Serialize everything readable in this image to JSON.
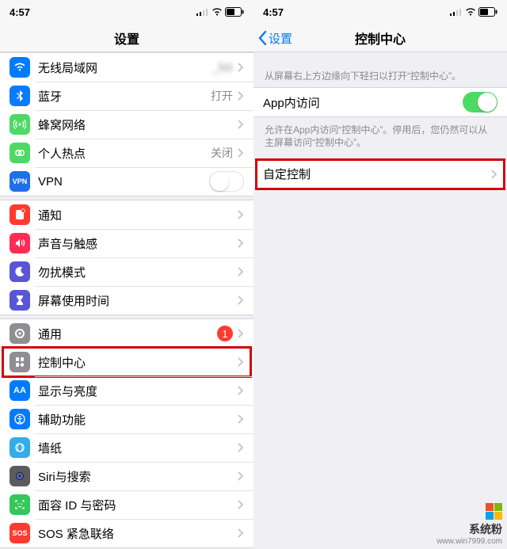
{
  "status": {
    "time": "4:57"
  },
  "left": {
    "title": "设置",
    "rows": {
      "wifi": {
        "label": "无线局域网",
        "value": "_5G"
      },
      "bluetooth": {
        "label": "蓝牙",
        "value": "打开"
      },
      "cellular": {
        "label": "蜂窝网络"
      },
      "hotspot": {
        "label": "个人热点",
        "value": "关闭"
      },
      "vpn": {
        "label": "VPN"
      },
      "notify": {
        "label": "通知"
      },
      "sound": {
        "label": "声音与触感"
      },
      "dnd": {
        "label": "勿扰模式"
      },
      "screentime": {
        "label": "屏幕使用时间"
      },
      "general": {
        "label": "通用",
        "badge": "1"
      },
      "control": {
        "label": "控制中心"
      },
      "display": {
        "label": "显示与亮度"
      },
      "access": {
        "label": "辅助功能"
      },
      "wallpaper": {
        "label": "墙纸"
      },
      "siri": {
        "label": "Siri与搜索"
      },
      "faceid": {
        "label": "面容 ID 与密码"
      },
      "sos": {
        "label": "SOS 紧急联络"
      }
    }
  },
  "right": {
    "back": "设置",
    "title": "控制中心",
    "hint": "从屏幕右上方边缘向下轻扫以打开“控制中心”。",
    "inapp": {
      "label": "App内访问",
      "on": true
    },
    "inapp_desc": "允许在App内访问“控制中心”。停用后，您仍然可以从主屏幕访问“控制中心”。",
    "custom": {
      "label": "自定控制"
    }
  },
  "watermark": {
    "brand": "系统粉",
    "url": "www.win7999.com"
  }
}
